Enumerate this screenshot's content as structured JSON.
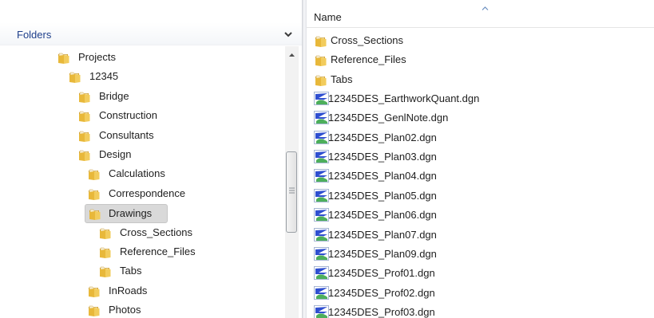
{
  "tree": {
    "header": "Folders",
    "items": [
      {
        "label": "Projects",
        "level": 0
      },
      {
        "label": "12345",
        "level": 1
      },
      {
        "label": "Bridge",
        "level": 2
      },
      {
        "label": "Construction",
        "level": 2
      },
      {
        "label": "Consultants",
        "level": 2
      },
      {
        "label": "Design",
        "level": 2
      },
      {
        "label": "Calculations",
        "level": 3
      },
      {
        "label": "Correspondence",
        "level": 3
      },
      {
        "label": "Drawings",
        "level": 3,
        "selected": true
      },
      {
        "label": "Cross_Sections",
        "level": 4
      },
      {
        "label": "Reference_Files",
        "level": 4
      },
      {
        "label": "Tabs",
        "level": 4
      },
      {
        "label": "InRoads",
        "level": 3
      },
      {
        "label": "Photos",
        "level": 3
      }
    ]
  },
  "list": {
    "column_header": "Name",
    "items": [
      {
        "label": "Cross_Sections",
        "type": "folder"
      },
      {
        "label": "Reference_Files",
        "type": "folder"
      },
      {
        "label": "Tabs",
        "type": "folder"
      },
      {
        "label": "12345DES_EarthworkQuant.dgn",
        "type": "dgn"
      },
      {
        "label": "12345DES_GenlNote.dgn",
        "type": "dgn"
      },
      {
        "label": "12345DES_Plan02.dgn",
        "type": "dgn"
      },
      {
        "label": "12345DES_Plan03.dgn",
        "type": "dgn"
      },
      {
        "label": "12345DES_Plan04.dgn",
        "type": "dgn"
      },
      {
        "label": "12345DES_Plan05.dgn",
        "type": "dgn"
      },
      {
        "label": "12345DES_Plan06.dgn",
        "type": "dgn"
      },
      {
        "label": "12345DES_Plan07.dgn",
        "type": "dgn"
      },
      {
        "label": "12345DES_Plan09.dgn",
        "type": "dgn"
      },
      {
        "label": "12345DES_Prof01.dgn",
        "type": "dgn"
      },
      {
        "label": "12345DES_Prof02.dgn",
        "type": "dgn"
      },
      {
        "label": "12345DES_Prof03.dgn",
        "type": "dgn"
      }
    ]
  },
  "icons": {
    "folder": "folder-icon",
    "dgn": "dgn-file-icon",
    "header_chevron": "chevron-down-icon",
    "sort": "sort-ascending-icon",
    "scroll_up": "scroll-up-arrow-icon",
    "thumb_grip": "scrollbar-grip-icon"
  },
  "colors": {
    "header_text": "#1e3f8b",
    "selection_bg": "#d9d9d9",
    "folder_yellow": "#e8b83a",
    "dgn_blue": "#2f4fd0",
    "dgn_green": "#3aa64a"
  }
}
